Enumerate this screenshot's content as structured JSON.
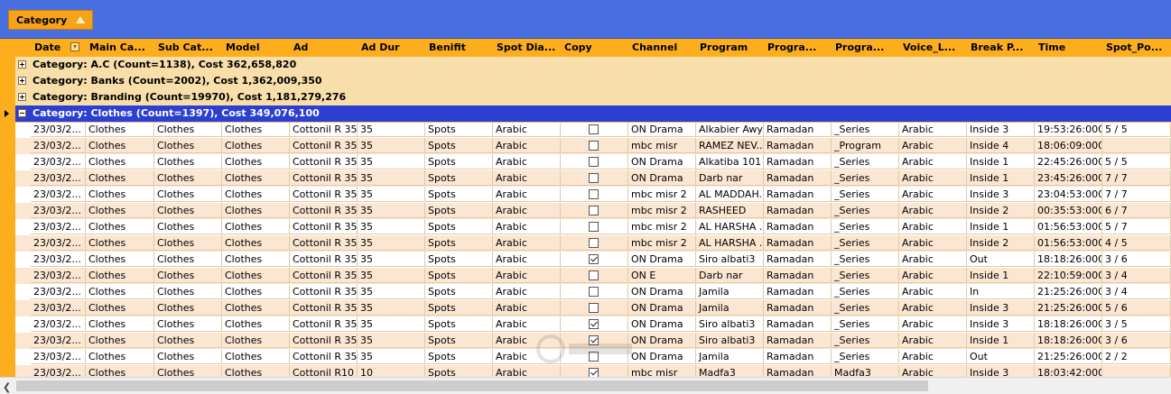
{
  "groupbar": {
    "chip_label": "Category"
  },
  "columns": [
    "Date",
    "Main Ca...",
    "Sub Cat...",
    "Model",
    "Ad",
    "Ad Dur",
    "Benifit",
    "Spot Dia...",
    "Copy",
    "Channel",
    "Program",
    "Progra...",
    "Progra...",
    "Voice_L...",
    "Break P...",
    "Time",
    "Spot_Po..."
  ],
  "groups": [
    {
      "label": "Category: A.C (Count=1138), Cost 362,658,820"
    },
    {
      "label": "Category: Banks (Count=2002), Cost 1,362,009,350"
    },
    {
      "label": "Category: Branding (Count=19970), Cost 1,181,279,276"
    },
    {
      "label": "Category: Clothes (Count=1397), Cost 349,076,100"
    }
  ],
  "rows": [
    {
      "date": "23/03/2...",
      "main": "Clothes",
      "sub": "Clothes",
      "model": "Clothes",
      "ad": "Cottonil  R 35",
      "dur": "35",
      "benifit": "Spots",
      "dia": "Arabic",
      "copy": false,
      "channel": "ON Drama",
      "program": "Alkabier Awy",
      "prog2": "Ramadan",
      "prog3": "_Series",
      "voice": "Arabic",
      "brk": "Inside 3",
      "time": "19:53:26:000",
      "spot": "5 / 5"
    },
    {
      "date": "23/03/2...",
      "main": "Clothes",
      "sub": "Clothes",
      "model": "Clothes",
      "ad": "Cottonil  R 35",
      "dur": "35",
      "benifit": "Spots",
      "dia": "Arabic",
      "copy": false,
      "channel": "mbc misr",
      "program": "RAMEZ NEV...",
      "prog2": "Ramadan",
      "prog3": "_Program",
      "voice": "Arabic",
      "brk": "Inside 4",
      "time": "18:06:09:000",
      "spot": ""
    },
    {
      "date": "23/03/2...",
      "main": "Clothes",
      "sub": "Clothes",
      "model": "Clothes",
      "ad": "Cottonil  R 35",
      "dur": "35",
      "benifit": "Spots",
      "dia": "Arabic",
      "copy": false,
      "channel": "ON Drama",
      "program": "Alkatiba 101",
      "prog2": "Ramadan",
      "prog3": "_Series",
      "voice": "Arabic",
      "brk": "Inside 1",
      "time": "22:45:26:000",
      "spot": "5 / 5"
    },
    {
      "date": "23/03/2...",
      "main": "Clothes",
      "sub": "Clothes",
      "model": "Clothes",
      "ad": "Cottonil  R 35",
      "dur": "35",
      "benifit": "Spots",
      "dia": "Arabic",
      "copy": false,
      "channel": "ON Drama",
      "program": "Darb nar",
      "prog2": "Ramadan",
      "prog3": "_Series",
      "voice": "Arabic",
      "brk": "Inside 1",
      "time": "23:45:26:000",
      "spot": "7 / 7"
    },
    {
      "date": "23/03/2...",
      "main": "Clothes",
      "sub": "Clothes",
      "model": "Clothes",
      "ad": "Cottonil  R 35",
      "dur": "35",
      "benifit": "Spots",
      "dia": "Arabic",
      "copy": false,
      "channel": "mbc misr 2",
      "program": "AL MADDAH...",
      "prog2": "Ramadan",
      "prog3": "_Series",
      "voice": "Arabic",
      "brk": "Inside 3",
      "time": "23:04:53:000",
      "spot": "7 / 7"
    },
    {
      "date": "23/03/2...",
      "main": "Clothes",
      "sub": "Clothes",
      "model": "Clothes",
      "ad": "Cottonil  R 35",
      "dur": "35",
      "benifit": "Spots",
      "dia": "Arabic",
      "copy": false,
      "channel": "mbc misr 2",
      "program": "RASHEED",
      "prog2": "Ramadan",
      "prog3": "_Series",
      "voice": "Arabic",
      "brk": "Inside 2",
      "time": "00:35:53:000",
      "spot": "6 / 7"
    },
    {
      "date": "23/03/2...",
      "main": "Clothes",
      "sub": "Clothes",
      "model": "Clothes",
      "ad": "Cottonil  R 35",
      "dur": "35",
      "benifit": "Spots",
      "dia": "Arabic",
      "copy": false,
      "channel": "mbc misr 2",
      "program": "AL HARSHA ...",
      "prog2": "Ramadan",
      "prog3": "_Series",
      "voice": "Arabic",
      "brk": "Inside 1",
      "time": "01:56:53:000",
      "spot": "5 / 7"
    },
    {
      "date": "23/03/2...",
      "main": "Clothes",
      "sub": "Clothes",
      "model": "Clothes",
      "ad": "Cottonil  R 35",
      "dur": "35",
      "benifit": "Spots",
      "dia": "Arabic",
      "copy": false,
      "channel": "mbc misr 2",
      "program": "AL HARSHA ...",
      "prog2": "Ramadan",
      "prog3": "_Series",
      "voice": "Arabic",
      "brk": "Inside 2",
      "time": "01:56:53:000",
      "spot": "4 / 5"
    },
    {
      "date": "23/03/2...",
      "main": "Clothes",
      "sub": "Clothes",
      "model": "Clothes",
      "ad": "Cottonil  R 35",
      "dur": "35",
      "benifit": "Spots",
      "dia": "Arabic",
      "copy": true,
      "channel": "ON Drama",
      "program": "Siro albati3",
      "prog2": "Ramadan",
      "prog3": "_Series",
      "voice": "Arabic",
      "brk": "Out",
      "time": "18:18:26:000",
      "spot": "3 / 6"
    },
    {
      "date": "23/03/2...",
      "main": "Clothes",
      "sub": "Clothes",
      "model": "Clothes",
      "ad": "Cottonil  R 35",
      "dur": "35",
      "benifit": "Spots",
      "dia": "Arabic",
      "copy": false,
      "channel": "ON E",
      "program": "Darb nar",
      "prog2": "Ramadan",
      "prog3": "_Series",
      "voice": "Arabic",
      "brk": "Inside 1",
      "time": "22:10:59:000",
      "spot": "3 / 4"
    },
    {
      "date": "23/03/2...",
      "main": "Clothes",
      "sub": "Clothes",
      "model": "Clothes",
      "ad": "Cottonil  R 35",
      "dur": "35",
      "benifit": "Spots",
      "dia": "Arabic",
      "copy": false,
      "channel": "ON Drama",
      "program": "Jamila",
      "prog2": "Ramadan",
      "prog3": "_Series",
      "voice": "Arabic",
      "brk": "In",
      "time": "21:25:26:000",
      "spot": "3 / 4"
    },
    {
      "date": "23/03/2...",
      "main": "Clothes",
      "sub": "Clothes",
      "model": "Clothes",
      "ad": "Cottonil  R 35",
      "dur": "35",
      "benifit": "Spots",
      "dia": "Arabic",
      "copy": false,
      "channel": "ON Drama",
      "program": "Jamila",
      "prog2": "Ramadan",
      "prog3": "_Series",
      "voice": "Arabic",
      "brk": "Inside 3",
      "time": "21:25:26:000",
      "spot": "5 / 6"
    },
    {
      "date": "23/03/2...",
      "main": "Clothes",
      "sub": "Clothes",
      "model": "Clothes",
      "ad": "Cottonil  R 35",
      "dur": "35",
      "benifit": "Spots",
      "dia": "Arabic",
      "copy": true,
      "channel": "ON Drama",
      "program": "Siro albati3",
      "prog2": "Ramadan",
      "prog3": "_Series",
      "voice": "Arabic",
      "brk": "Inside 3",
      "time": "18:18:26:000",
      "spot": "3 / 5"
    },
    {
      "date": "23/03/2...",
      "main": "Clothes",
      "sub": "Clothes",
      "model": "Clothes",
      "ad": "Cottonil  R 35",
      "dur": "35",
      "benifit": "Spots",
      "dia": "Arabic",
      "copy": true,
      "channel": "ON Drama",
      "program": "Siro albati3",
      "prog2": "Ramadan",
      "prog3": "_Series",
      "voice": "Arabic",
      "brk": "Inside 1",
      "time": "18:18:26:000",
      "spot": "3 / 6"
    },
    {
      "date": "23/03/2...",
      "main": "Clothes",
      "sub": "Clothes",
      "model": "Clothes",
      "ad": "Cottonil  R 35",
      "dur": "35",
      "benifit": "Spots",
      "dia": "Arabic",
      "copy": false,
      "channel": "ON Drama",
      "program": "Jamila",
      "prog2": "Ramadan",
      "prog3": "_Series",
      "voice": "Arabic",
      "brk": "Out",
      "time": "21:25:26:000",
      "spot": "2 / 2"
    },
    {
      "date": "23/03/2...",
      "main": "Clothes",
      "sub": "Clothes",
      "model": "Clothes",
      "ad": "Cottonil R10",
      "dur": "10",
      "benifit": "Spots",
      "dia": "Arabic",
      "copy": true,
      "channel": "mbc misr",
      "program": "Madfa3",
      "prog2": "Ramadan",
      "prog3": "Madfa3",
      "voice": "Arabic",
      "brk": "Inside 3",
      "time": "18:03:42:000",
      "spot": ""
    }
  ],
  "icons": {
    "sort": "sort-ascending-icon",
    "filter": "filter-icon",
    "expand": "plus-expander-icon",
    "collapse": "minus-expander-icon",
    "scroll": "chevron-left-icon"
  },
  "colors": {
    "groupbar": "#4a6fe0",
    "header": "#fdae1c",
    "group_row": "#f7deaa",
    "active_group": "#2c3fd1",
    "alt_row": "#fbe6d2"
  }
}
